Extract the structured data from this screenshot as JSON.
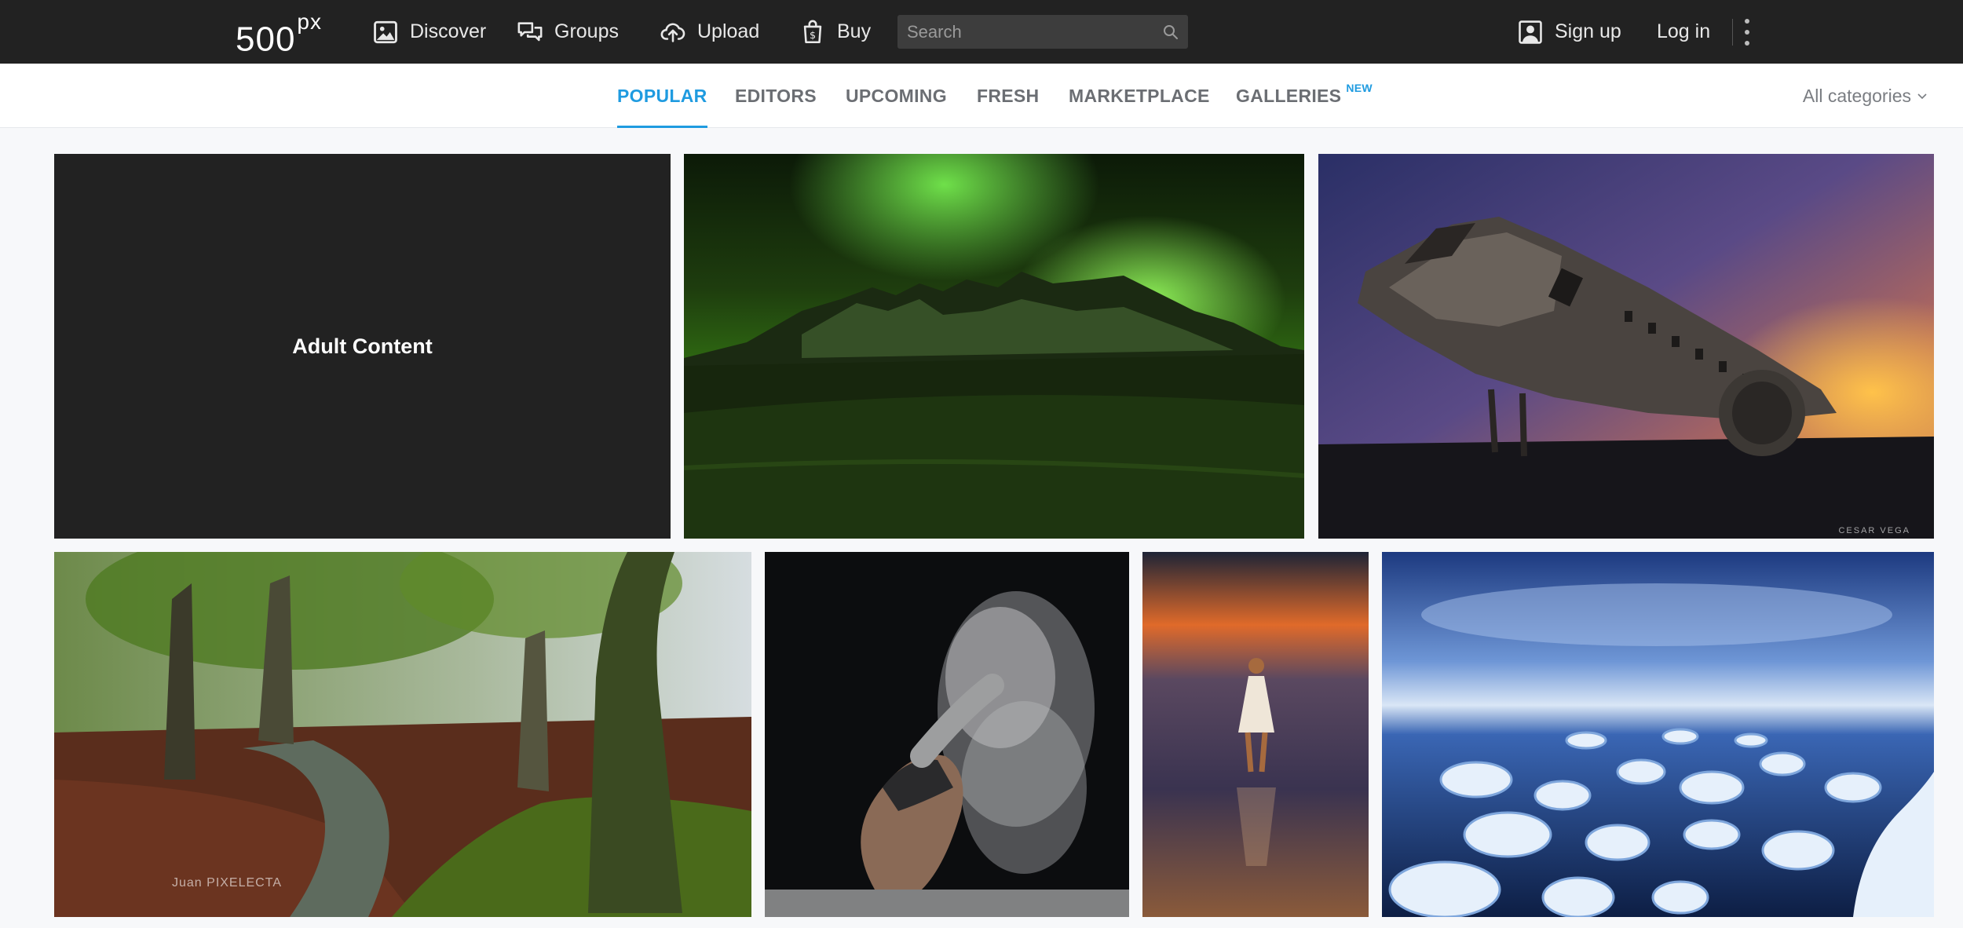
{
  "header": {
    "logo_text": "500",
    "logo_sup": "px",
    "nav": [
      {
        "label": "Discover",
        "icon": "image-icon"
      },
      {
        "label": "Groups",
        "icon": "chat-bubbles-icon"
      },
      {
        "label": "Upload",
        "icon": "cloud-upload-icon"
      },
      {
        "label": "Buy",
        "icon": "shopping-bag-icon"
      }
    ],
    "search_placeholder": "Search",
    "sign_up": "Sign up",
    "log_in": "Log in"
  },
  "subnav": {
    "tabs": [
      {
        "label": "POPULAR",
        "active": true
      },
      {
        "label": "EDITORS",
        "active": false
      },
      {
        "label": "UPCOMING",
        "active": false
      },
      {
        "label": "FRESH",
        "active": false
      },
      {
        "label": "MARKETPLACE",
        "active": false
      },
      {
        "label": "GALLERIES",
        "active": false,
        "badge": "NEW"
      }
    ],
    "categories_label": "All categories"
  },
  "photos": {
    "adult_label": "Adult Content",
    "watermarks": {
      "plane": "CESAR VEGA",
      "forest": "Juan PIXELECTA"
    }
  },
  "colors": {
    "accent": "#1f9be0",
    "topbar": "#222222"
  }
}
